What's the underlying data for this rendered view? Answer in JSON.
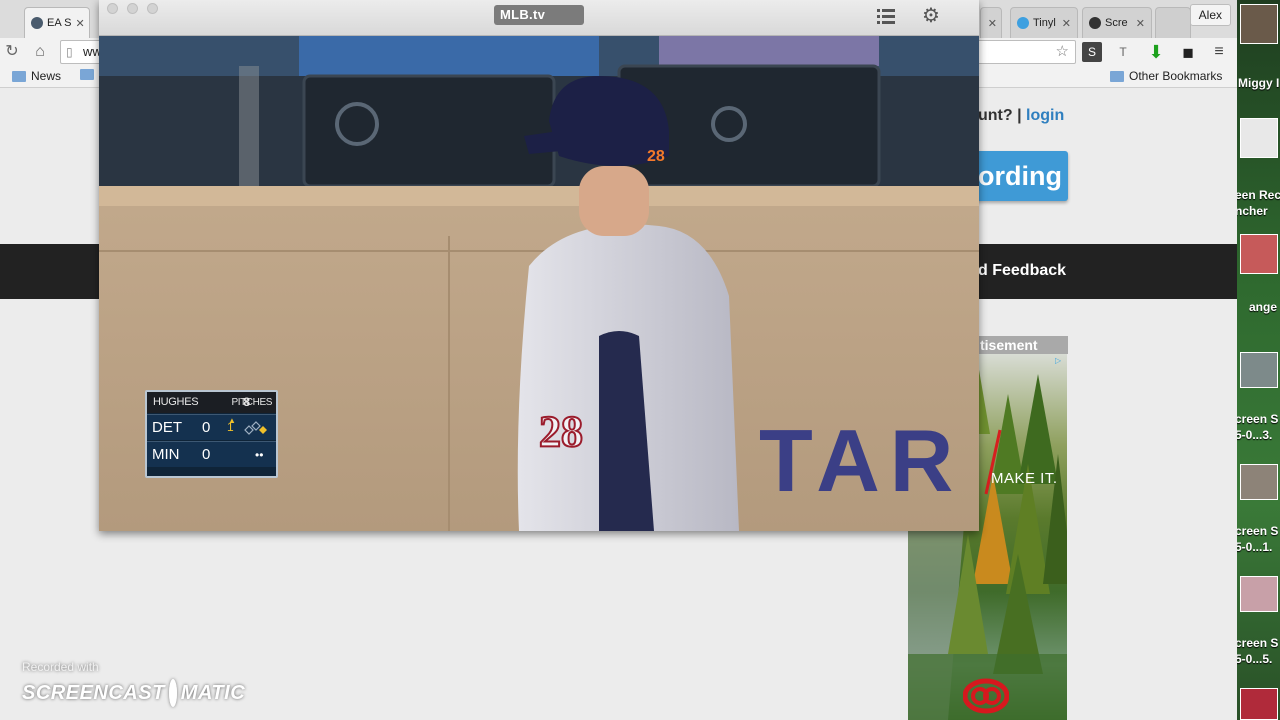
{
  "browser": {
    "tabs": [
      {
        "title": "EA S",
        "fav_color": "#4a5b6d"
      },
      {
        "title": "Tinyl",
        "fav_color": "#3ea0e0"
      },
      {
        "title": "Scre",
        "fav_color": "#333333"
      }
    ],
    "profile": "Alex",
    "url_partial": "ww",
    "bookmarks": {
      "news": "News",
      "other": "Other Bookmarks"
    }
  },
  "page": {
    "account_prefix": "unt? | ",
    "login_link": "login",
    "recording_button": "ording",
    "feedback_label": "d Feedback",
    "ad_label": "tisement",
    "ad_tagline": "MAKE IT."
  },
  "mlb": {
    "logo_text": "MLB.tv",
    "scoreboard": {
      "pitcher": "HUGHES",
      "pitch_count": "8",
      "pitches_label": "PITCHES",
      "away_team": "DET",
      "away_score": "0",
      "home_team": "MIN",
      "home_score": "0",
      "inning": "1",
      "outs_dots": "••"
    },
    "player_number": "28",
    "wall_text": "TAR"
  },
  "side_app": {
    "contacts": [
      {
        "name": "Miggy I"
      },
      {
        "name": "een Rec"
      },
      {
        "name": "ncher"
      },
      {
        "name": "ange"
      },
      {
        "name": "creen S"
      },
      {
        "name": "5-0...3."
      },
      {
        "name": "creen S"
      },
      {
        "name": "5-0...1."
      },
      {
        "name": "creen S"
      },
      {
        "name": "5-0...5."
      }
    ]
  },
  "watermark": {
    "recorded_with": "Recorded with",
    "brand_left": "SCREENCAST",
    "brand_right": "MATIC"
  },
  "colors": {
    "accent_blue": "#3f9ad6",
    "link_blue": "#2f7fbf",
    "score_yellow": "#f0c02a",
    "scorebug_navy": "#14314f"
  }
}
